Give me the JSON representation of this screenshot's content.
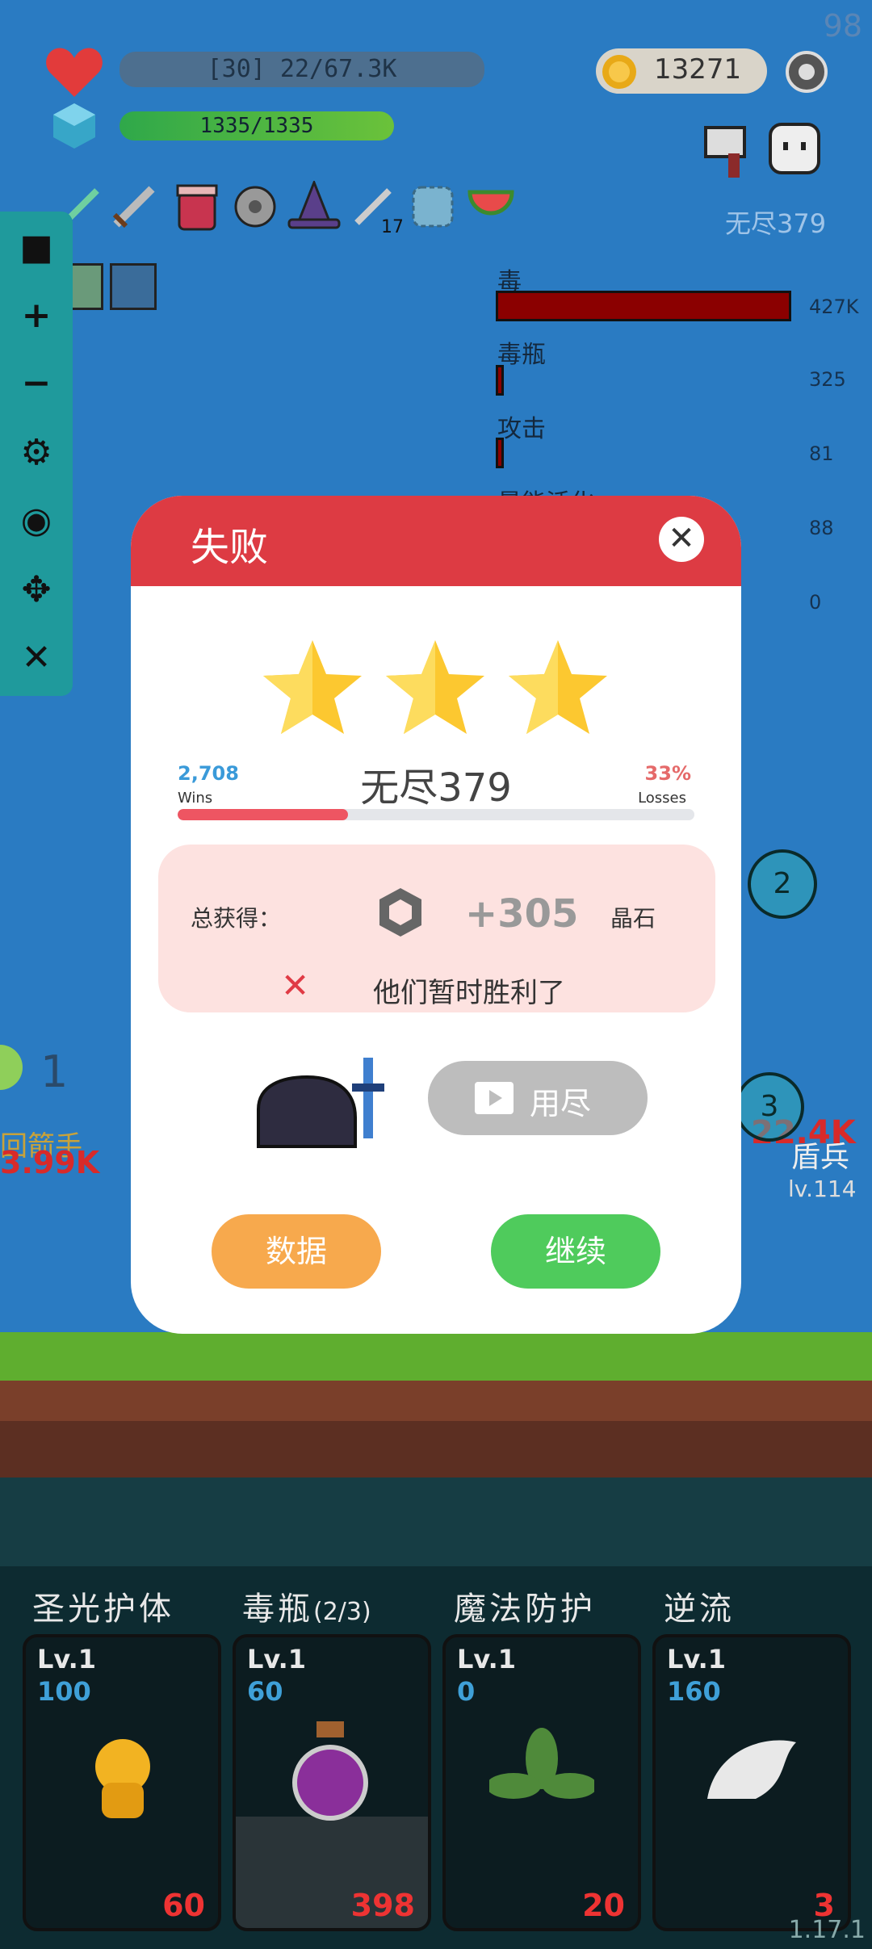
{
  "hud": {
    "hp_text": "[30] 22/67.3K",
    "mp_text": "1335/1335",
    "coins": "13271",
    "corner_num": "98",
    "endless_level": "无尽379"
  },
  "stats": [
    {
      "name": "毒",
      "value": "427K",
      "fill": 1.0
    },
    {
      "name": "毒瓶",
      "value": "325",
      "fill": 0.01
    },
    {
      "name": "攻击",
      "value": "81",
      "fill": 0.01
    },
    {
      "name": "最能活化",
      "value": "88",
      "fill": 0.0
    },
    {
      "name": "",
      "value": "0",
      "fill": 0.0
    }
  ],
  "scene": {
    "left_unit_name": "回箭手",
    "left_dmg": "3.99K",
    "left_kill": "1",
    "right_unit_name": "盾兵",
    "right_dmg": "22.4K",
    "right_level": "lv.114",
    "crosshair_2": "2",
    "crosshair_3": "3"
  },
  "dialog": {
    "title": "失败",
    "stars": 3,
    "wins_num": "2,708",
    "wins_label": "Wins",
    "losses_num": "33%",
    "losses_label": "Losses",
    "mode_name": "无尽379",
    "loss_fraction": 0.33,
    "reward_label": "总获得：",
    "reward_amount": "+305",
    "reward_unit": "晶石",
    "result_text": "他们暂时胜利了",
    "ad_label": "用尽",
    "data_button": "数据",
    "continue_button": "继续"
  },
  "skills": [
    {
      "title": "圣光护体",
      "lv": "Lv.1",
      "num": "100",
      "count": "60"
    },
    {
      "title": "毒瓶",
      "title_sub": "(2/3)",
      "lv": "Lv.1",
      "num": "60",
      "count": "398"
    },
    {
      "title": "魔法防护",
      "lv": "Lv.1",
      "num": "0",
      "count": "20"
    },
    {
      "title": "逆流",
      "lv": "Lv.1",
      "num": "160",
      "count": "3"
    }
  ],
  "version": "1.17.1",
  "colors": {
    "dialog_header": "#dd3b43",
    "star": "#fcc830",
    "data_button": "#f7a94d",
    "continue_button": "#4fcb5c"
  }
}
